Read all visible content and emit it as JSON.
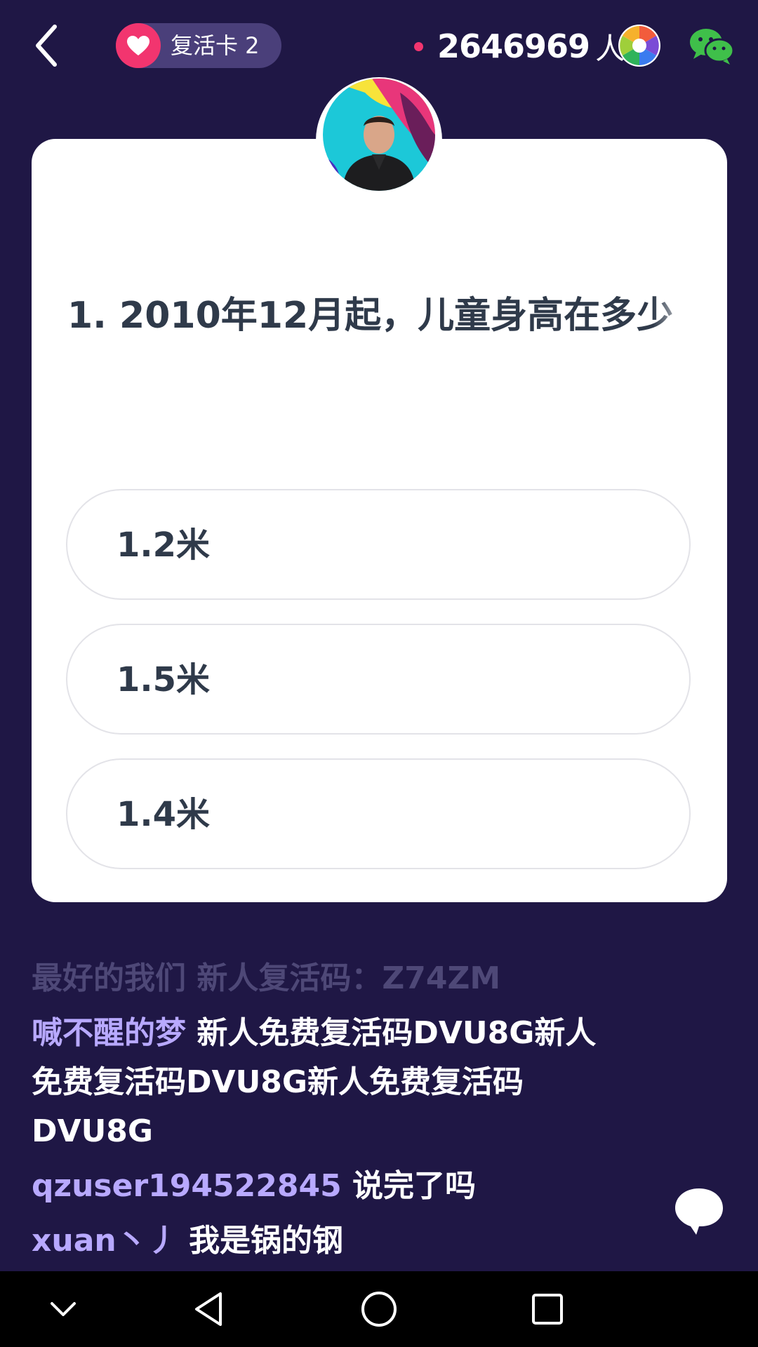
{
  "topbar": {
    "revive_label": "复活卡 2",
    "online_count": "2646969",
    "online_unit": "人",
    "icons": [
      "back-icon",
      "heart-icon",
      "camera-shutter-icon",
      "wechat-icon"
    ]
  },
  "quiz": {
    "question": "1. 2010年12月起，儿童身高在多少",
    "options": [
      {
        "label": "1.2米"
      },
      {
        "label": "1.5米"
      },
      {
        "label": "1.4米"
      }
    ]
  },
  "chat": {
    "messages": [
      {
        "user": "最好的我们",
        "text": "新人复活码：Z74ZM"
      },
      {
        "user": "喊不醒的梦",
        "text": "新人免费复活码DVU8G新人免费复活码DVU8G新人免费复活码DVU8G"
      },
      {
        "user": "qzuser194522845",
        "text": "说完了吗"
      },
      {
        "user": "xuan丶丿",
        "text": "我是锅的钢"
      }
    ]
  },
  "colors": {
    "background": "#1f1745",
    "accent_pink": "#f2356f",
    "username": "#b8a9ff",
    "question_text": "#2f3a4a"
  },
  "navbar": {
    "icons": [
      "collapse-icon",
      "back-triangle-icon",
      "home-circle-icon",
      "recents-square-icon"
    ]
  }
}
